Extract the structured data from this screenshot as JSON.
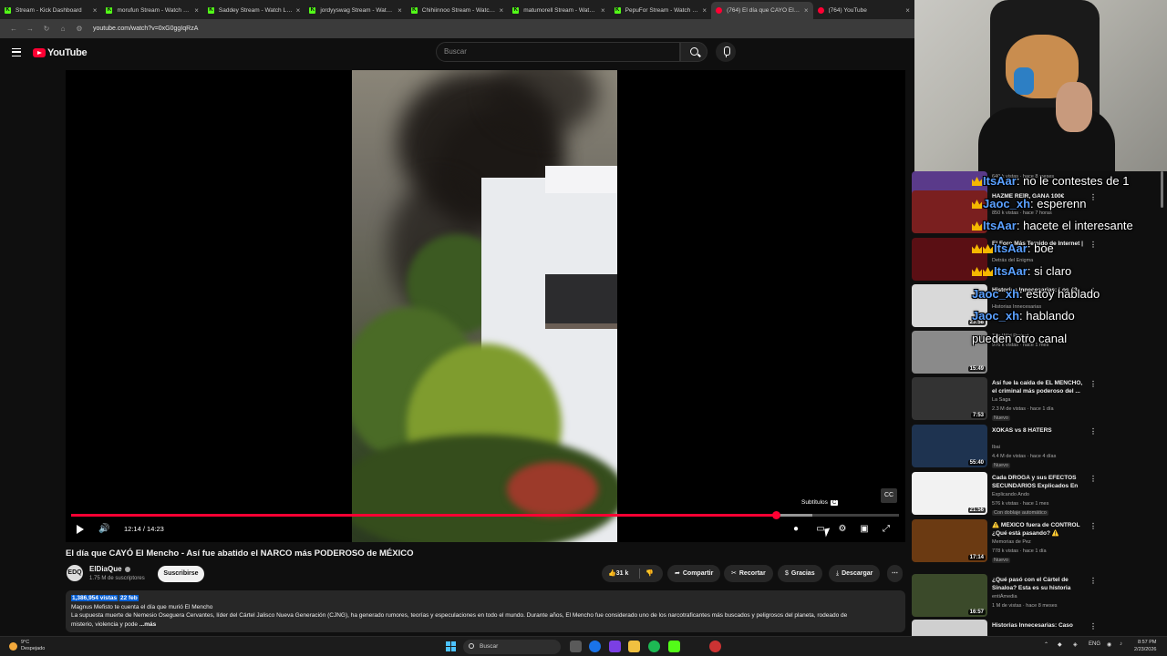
{
  "browser": {
    "tabs": [
      {
        "label": "Stream - Kick Dashboard",
        "type": "kick",
        "active": false
      },
      {
        "label": "morufun Stream - Watch Live o",
        "type": "kick",
        "active": false
      },
      {
        "label": "Saddey Stream - Watch Live o",
        "type": "kick",
        "active": false
      },
      {
        "label": "jordyyswag Stream - Watch Li",
        "type": "kick",
        "active": false
      },
      {
        "label": "Chihiinnoo Stream - Watch Live",
        "type": "kick",
        "active": false
      },
      {
        "label": "matumorell Stream - Watch Li",
        "type": "kick",
        "active": false
      },
      {
        "label": "PepuFor Stream - Watch Live",
        "type": "kick",
        "active": false
      },
      {
        "label": "(764) El día que CAYÓ El Menc",
        "type": "yt",
        "active": true
      },
      {
        "label": "(764) YouTube",
        "type": "yt",
        "active": false
      }
    ],
    "url": "youtube.com/watch?v=0xG0ggIqRzA",
    "close_glyph": "×"
  },
  "youtube": {
    "logo_text": "YouTube",
    "search_placeholder": "Buscar"
  },
  "player": {
    "time_display": "12:14 / 14:23",
    "progress_fraction": 0.851,
    "buffered_fraction": 0.895,
    "tooltip_label": "Subtítulos",
    "tooltip_key": "C",
    "badge_text": "CC"
  },
  "video": {
    "title": "El día que CAYÓ El Mencho - Así fue abatido el NARCO más PODEROSO de MÉXICO",
    "channel": "ElDiaQue",
    "avatar_text": "EDQ",
    "subscribers": "1.75 M de suscriptores",
    "subscribe_label": "Suscribirse",
    "likes": "31 k",
    "share_label": "Compartir",
    "clip_label": "Recortar",
    "thanks_label": "Gracias",
    "download_label": "Descargar",
    "more_glyph": "⋯",
    "views": "1,386,954 vistas",
    "date": "22 feb",
    "desc_line1": "Magnus Mefisto te cuenta el día que murió El Mencho",
    "desc_line2": "La supuesta muerte de Nemesio Oseguera Cervantes, líder del Cártel Jalisco Nueva Generación (CJNG), ha generado rumores, teorías y especulaciones en todo el mundo. Durante años, El Mencho fue considerado uno de los narcotraficantes más buscados y peligrosos del planeta, rodeado de",
    "desc_line3": "misterio, violencia y pode",
    "desc_more": "...más"
  },
  "recommendations": [
    {
      "title": "",
      "channel": "",
      "meta": "640 k vistas · hace 8 meses",
      "duration": "",
      "badge": "",
      "thumb": "#5a3a8a"
    },
    {
      "title": "HAZME REÍR, GANA 100€",
      "channel": "",
      "meta": "850 k vistas · hace 7 horas",
      "duration": "",
      "badge": "",
      "thumb": "#7a1f1f"
    },
    {
      "title": "El Foro Más Temido de Internet |",
      "channel": "Detrás del Enigma",
      "meta": "",
      "duration": "",
      "badge": "",
      "thumb": "#5a0f14"
    },
    {
      "title": "Historias Innecesarias: Los 43",
      "channel": "Historias Innecesarias",
      "meta": "",
      "duration": "23:58",
      "badge": "",
      "thumb": "#d9d9d9"
    },
    {
      "title": "",
      "channel": "The Wild Project",
      "meta": "976 k vistas · hace 1 mes",
      "duration": "15:49",
      "badge": "",
      "thumb": "#8a8a8a"
    },
    {
      "title": "Así fue la caída de EL MENCHO, el criminal más poderoso del ...",
      "channel": "La Saga",
      "meta": "2.3 M de vistas · hace 1 día",
      "duration": "7:53",
      "badge": "Nuevo",
      "thumb": "#333333"
    },
    {
      "title": "XOKAS vs 8 HATERS",
      "channel": "Ibai",
      "meta": "4.4 M de vistas · hace 4 días",
      "duration": "55:40",
      "badge": "Nuevo",
      "thumb": "#1e3350"
    },
    {
      "title": "Cada DROGA y sus EFECTOS SECUNDARIOS Explicados En ...",
      "channel": "Explicando Ando",
      "meta": "576 k vistas · hace 1 mes",
      "duration": "21:56",
      "badge": "Con doblaje automático",
      "thumb": "#f2f2f2"
    },
    {
      "title": "⚠️ MÉXICO fuera de CONTROL ¿Qué está pasando? ⚠️",
      "channel": "Memorias de Pez",
      "meta": "778 k vistas · hace 1 día",
      "duration": "17:14",
      "badge": "Nuevo",
      "thumb": "#6b3a12"
    },
    {
      "title": "¿Qué pasó con el Cártel de Sinaloa? Esta es su historia",
      "channel": "entiÁmedia",
      "meta": "1 M de vistas · hace 8 meses",
      "duration": "16:57",
      "badge": "",
      "thumb": "#3b4a2a"
    },
    {
      "title": "Historias Innecesarias: Caso",
      "channel": "",
      "meta": "",
      "duration": "",
      "badge": "",
      "thumb": "#cfcfcf"
    }
  ],
  "chat": [
    {
      "user": "ItsAar",
      "message": ": no le contestes de 1",
      "badges": 1
    },
    {
      "user": "Jaoc_xh",
      "message": ": esperenn",
      "badges": 1
    },
    {
      "user": "ItsAar",
      "message": ": hacete el interesante",
      "badges": 1
    },
    {
      "user": "ItsAar",
      "message": ": boe",
      "badges": 2
    },
    {
      "user": "ItsAar",
      "message": ": si claro",
      "badges": 2
    },
    {
      "user": "Jaoc_xh",
      "message": ": estoy hablado",
      "badges": 0
    },
    {
      "user": "Jaoc_xh",
      "message": ": hablando",
      "badges": 0
    },
    {
      "user": "",
      "message": "pueden otro canal",
      "badges": 0
    }
  ],
  "taskbar": {
    "temp": "9°C",
    "weather": "Despejado",
    "search": "Buscar",
    "lang": "ENG",
    "time": "8:57 PM",
    "date": "2/23/2026"
  },
  "colors": {
    "accent": "#ff0033",
    "kick": "#53fc18",
    "chat_user": "#5aa0ff"
  }
}
